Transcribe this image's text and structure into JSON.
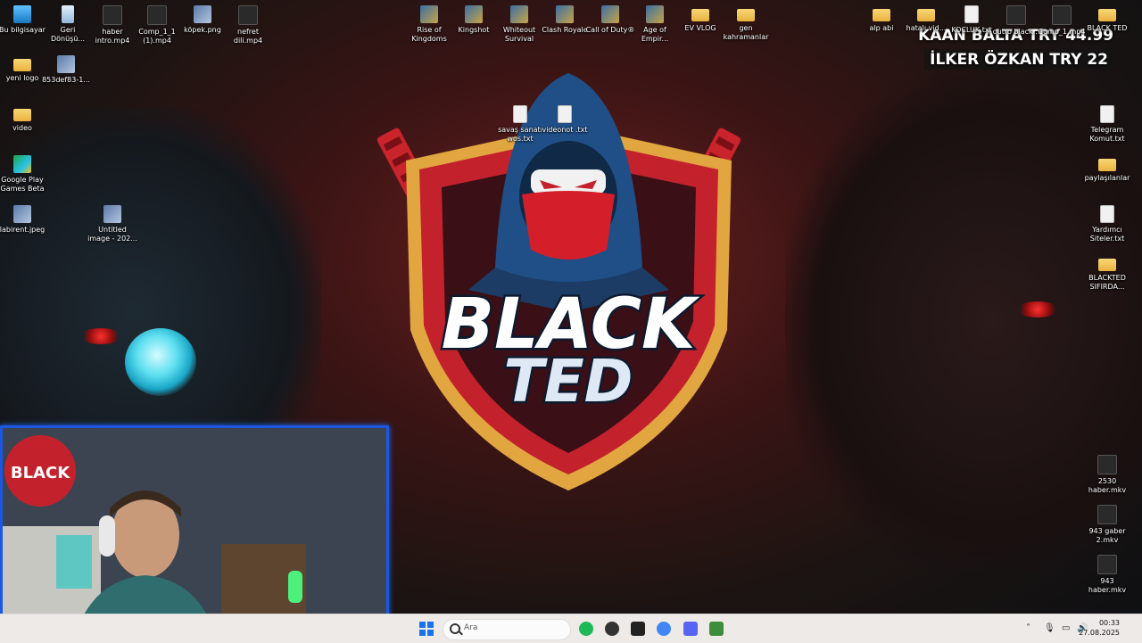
{
  "desktop": {
    "icons_left": [
      {
        "label": "Bu bilgisayar",
        "kind": "pc"
      },
      {
        "label": "Geri Dönüşü...",
        "kind": "bin"
      },
      {
        "label": "haber intro.mp4",
        "kind": "video"
      },
      {
        "label": "Comp_1_1 (1).mp4",
        "kind": "video"
      },
      {
        "label": "köpek.png",
        "kind": "img"
      },
      {
        "label": "nefret dili.mp4",
        "kind": "video"
      },
      {
        "label": "yeni logo",
        "kind": "folder"
      },
      {
        "label": "853def83-1...",
        "kind": "img"
      },
      {
        "label": "video",
        "kind": "folder"
      },
      {
        "label": "Google Play Games Beta",
        "kind": "gp"
      },
      {
        "label": "labirent.jpeg",
        "kind": "img"
      },
      {
        "label": "Untitled image - 202...",
        "kind": "img"
      }
    ],
    "icons_top": [
      {
        "label": "Rise of Kingdoms",
        "kind": "app"
      },
      {
        "label": "Kingshot",
        "kind": "app"
      },
      {
        "label": "Whiteout Survival",
        "kind": "app"
      },
      {
        "label": "Clash Royale",
        "kind": "app"
      },
      {
        "label": "Call of Duty®",
        "kind": "app"
      },
      {
        "label": "Age of Empir...",
        "kind": "app"
      },
      {
        "label": "EV VLOG",
        "kind": "folder"
      },
      {
        "label": "gen kahramanlar",
        "kind": "folder"
      }
    ],
    "icons_right": [
      {
        "label": "alp abi",
        "kind": "folder"
      },
      {
        "label": "hatalı vid...",
        "kind": "folder"
      },
      {
        "label": "KOCLUK.txt",
        "kind": "file"
      },
      {
        "label": "outro black...",
        "kind": "video"
      },
      {
        "label": "Comp_1.mp4",
        "kind": "video"
      },
      {
        "label": "BLACK TED",
        "kind": "folder"
      },
      {
        "label": "Telegram Komut.txt",
        "kind": "file"
      },
      {
        "label": "paylaşılanlar",
        "kind": "folder"
      },
      {
        "label": "Yardımcı Siteler.txt",
        "kind": "file"
      },
      {
        "label": "BLACKTED SIFIRDA...",
        "kind": "folder"
      },
      {
        "label": "2530 haber.mkv",
        "kind": "video"
      },
      {
        "label": "943 gaber 2.mkv",
        "kind": "video"
      },
      {
        "label": "943 haber.mkv",
        "kind": "video"
      }
    ],
    "icons_center": [
      {
        "label": "savaş sanatı wos.txt",
        "kind": "file"
      },
      {
        "label": "videonot .txt",
        "kind": "file"
      }
    ]
  },
  "wallpaper": {
    "logo_line1": "BLACK",
    "logo_line2": "TED",
    "accent": "#d42a2a",
    "shield_border": "#e1a640"
  },
  "donations": [
    {
      "text": "KAAN BALTA  TRY 44.99"
    },
    {
      "text": "İLKER ÖZKAN  TRY 22"
    }
  ],
  "webcam": {
    "border_color": "#1d56e0"
  },
  "taskbar": {
    "search_placeholder": "Ara",
    "apps": [
      {
        "name": "spotify-icon",
        "color": "#1db954"
      },
      {
        "name": "record-icon",
        "color": "#333333"
      },
      {
        "name": "capcut-icon",
        "color": "#222222"
      },
      {
        "name": "chrome-icon",
        "color": "#4285f4"
      },
      {
        "name": "discord-icon",
        "color": "#5865f2"
      },
      {
        "name": "money-icon",
        "color": "#3c8d3c"
      }
    ],
    "time": "00:33",
    "date": "27.08.2025"
  }
}
